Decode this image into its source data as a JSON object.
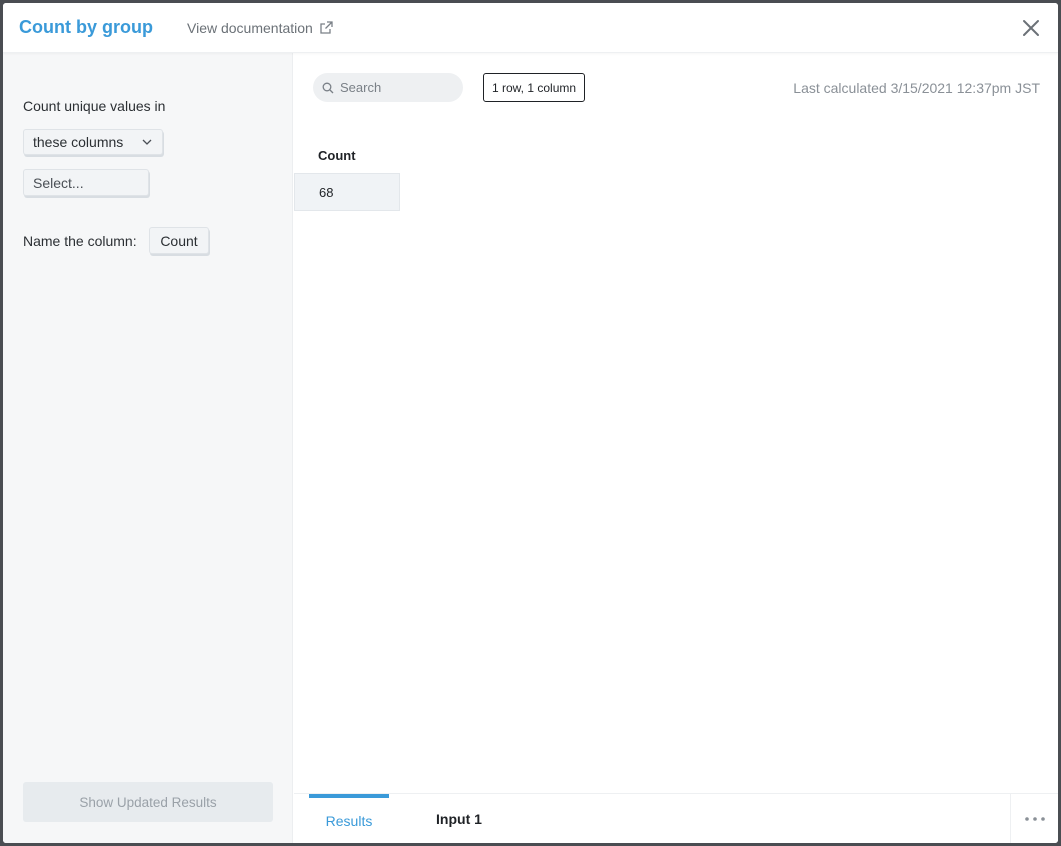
{
  "header": {
    "title": "Count by group",
    "doc_link": "View documentation",
    "close_icon": "close-icon"
  },
  "sidebar": {
    "count_label": "Count unique values in",
    "mode_select": "these columns",
    "columns_placeholder": "Select...",
    "name_label": "Name the column:",
    "name_value": "Count",
    "update_button": "Show Updated Results"
  },
  "results": {
    "search_placeholder": "Search",
    "dimensions": "1 row, 1 column",
    "last_calculated": "Last calculated 3/15/2021 12:37pm JST",
    "columns": [
      "Count"
    ],
    "rows": [
      [
        "68"
      ]
    ]
  },
  "footer": {
    "tabs": [
      {
        "label": "Results",
        "active": true
      },
      {
        "label": "Input 1",
        "active": false
      }
    ],
    "more_icon": "more-icon"
  },
  "colors": {
    "accent": "#3a9ad9",
    "backdrop": "#4a4d52"
  }
}
